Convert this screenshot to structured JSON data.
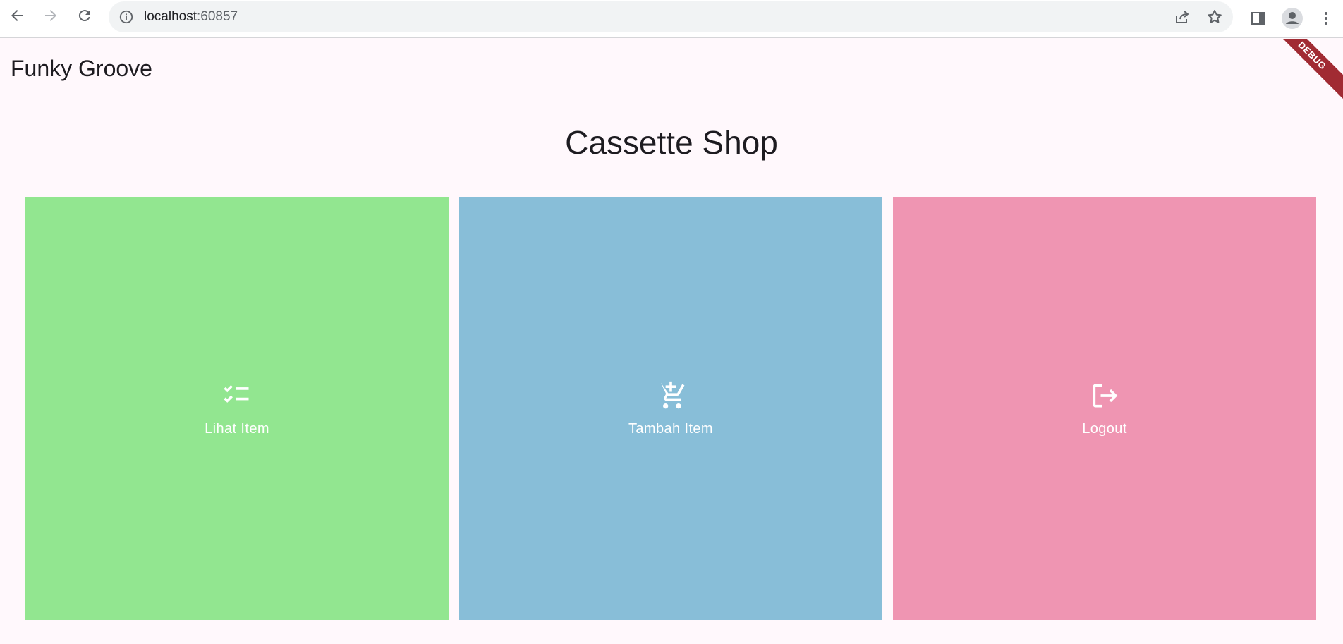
{
  "browser": {
    "url_host": "localhost",
    "url_port": ":60857"
  },
  "app": {
    "title": "Funky Groove",
    "heading": "Cassette Shop",
    "debug_label": "DEBUG"
  },
  "cards": [
    {
      "label": "Lihat Item",
      "icon": "checklist-icon",
      "color": "#92e690"
    },
    {
      "label": "Tambah Item",
      "icon": "add-cart-icon",
      "color": "#88bed8"
    },
    {
      "label": "Logout",
      "icon": "logout-icon",
      "color": "#ef95b2"
    }
  ]
}
